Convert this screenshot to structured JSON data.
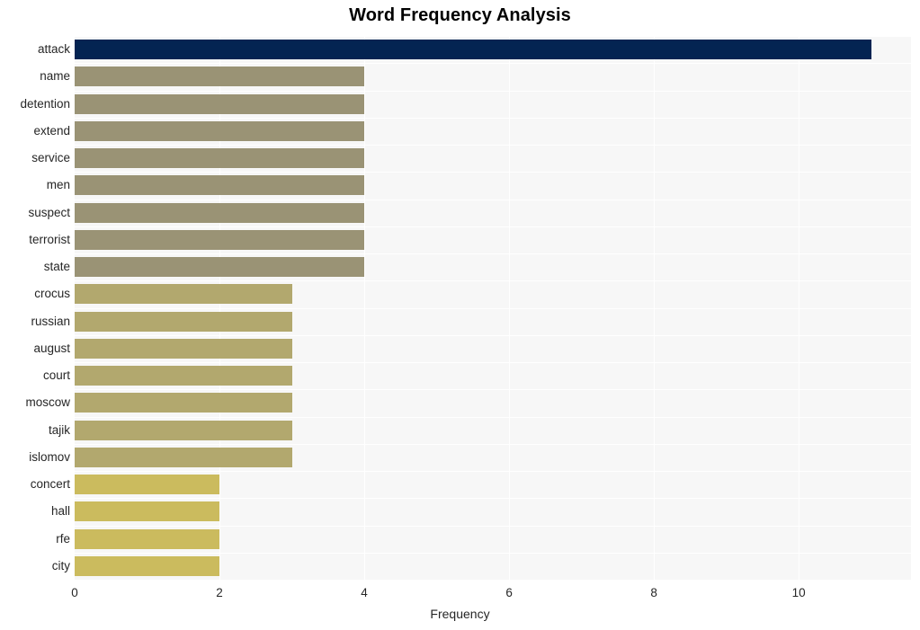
{
  "chart_data": {
    "type": "bar",
    "orientation": "horizontal",
    "title": "Word Frequency Analysis",
    "xlabel": "Frequency",
    "ylabel": "",
    "categories": [
      "attack",
      "name",
      "detention",
      "extend",
      "service",
      "men",
      "suspect",
      "terrorist",
      "state",
      "crocus",
      "russian",
      "august",
      "court",
      "moscow",
      "tajik",
      "islomov",
      "concert",
      "hall",
      "rfe",
      "city"
    ],
    "values": [
      11,
      4,
      4,
      4,
      4,
      4,
      4,
      4,
      4,
      3,
      3,
      3,
      3,
      3,
      3,
      3,
      2,
      2,
      2,
      2
    ],
    "xlim": [
      0,
      11.55
    ],
    "xticks": [
      0,
      2,
      4,
      6,
      8,
      10
    ],
    "xtick_labels": [
      "0",
      "2",
      "4",
      "6",
      "8",
      "10"
    ],
    "grid": true,
    "legend": false,
    "bar_colors": [
      "#042452",
      "#9a9375",
      "#9a9375",
      "#9a9375",
      "#9a9375",
      "#9a9375",
      "#9a9375",
      "#9a9375",
      "#9a9375",
      "#b2a86e",
      "#b2a86e",
      "#b2a86e",
      "#b2a86e",
      "#b2a86e",
      "#b2a86e",
      "#b2a86e",
      "#cbbb5e",
      "#cbbb5e",
      "#cbbb5e",
      "#cbbb5e"
    ],
    "plot_background": "#f7f7f7",
    "grid_color": "#ffffff",
    "figure_background": "#ffffff",
    "text_color": "#262626"
  }
}
